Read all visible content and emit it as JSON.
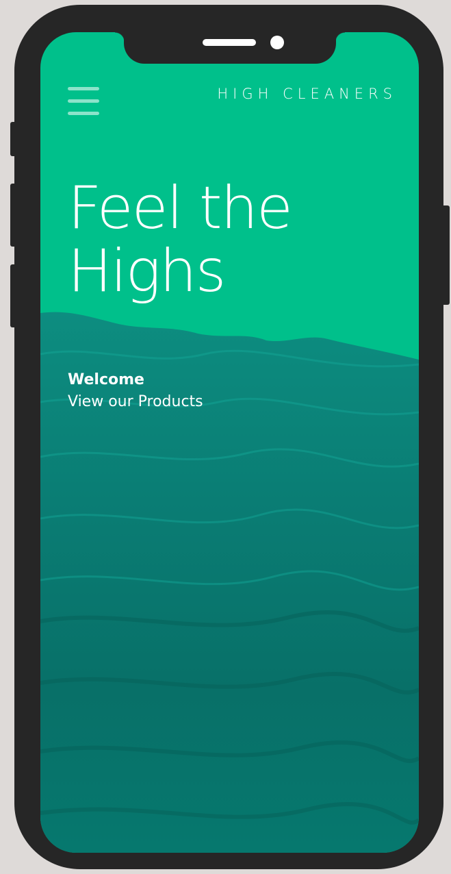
{
  "header": {
    "brand": "HIGH CLEANERS",
    "menu_icon": "hamburger-menu-icon"
  },
  "hero": {
    "line1": "Feel the",
    "line2": "Highs"
  },
  "intro": {
    "welcome": "Welcome",
    "link": "View our Products"
  },
  "colors": {
    "brand_green": "#00c08b",
    "sea_teal": "#0a7a72",
    "device_frame": "#262626",
    "page_background": "#dedad8"
  }
}
